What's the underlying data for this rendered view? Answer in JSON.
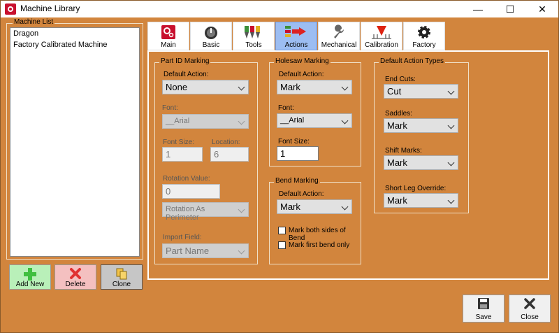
{
  "window": {
    "title": "Machine Library",
    "min_glyph": "—",
    "max_glyph": "☐",
    "close_glyph": "✕"
  },
  "machine_list": {
    "caption": "Machine List",
    "items": [
      "Dragon",
      "Factory Calibrated Machine"
    ]
  },
  "buttons": {
    "add_new": "Add New",
    "delete": "Delete",
    "clone": "Clone",
    "save": "Save",
    "close": "Close"
  },
  "tabs": [
    {
      "label": "Main",
      "icon": "main-settings-icon"
    },
    {
      "label": "Basic",
      "icon": "dial-icon"
    },
    {
      "label": "Tools",
      "icon": "tools-icon"
    },
    {
      "label": "Actions",
      "icon": "actions-icon"
    },
    {
      "label": "Mechanical",
      "icon": "wrench-icon"
    },
    {
      "label": "Calibration",
      "icon": "calibration-icon"
    },
    {
      "label": "Factory",
      "icon": "gear-icon"
    }
  ],
  "part_id": {
    "caption": "Part ID Marking",
    "default_action_label": "Default Action:",
    "default_action": "None",
    "font_label": "Font:",
    "font": "__Arial",
    "font_size_label": "Font Size:",
    "font_size": "1",
    "location_label": "Location:",
    "location": "6",
    "rotation_label": "Rotation Value:",
    "rotation_value": "0",
    "rotation_mode": "Rotation As Perimeter",
    "import_field_label": "Import Field:",
    "import_field": "Part Name"
  },
  "holesaw": {
    "caption": "Holesaw Marking",
    "default_action_label": "Default Action:",
    "default_action": "Mark",
    "font_label": "Font:",
    "font": "__Arial",
    "font_size_label": "Font Size:",
    "font_size": "1"
  },
  "bend": {
    "caption": "Bend Marking",
    "default_action_label": "Default Action:",
    "default_action": "Mark",
    "both_sides_label": "Mark both sides of Bend",
    "first_only_label": "Mark first bend only"
  },
  "default_types": {
    "caption": "Default Action Types",
    "end_cuts_label": "End Cuts:",
    "end_cuts": "Cut",
    "saddles_label": "Saddles:",
    "saddles": "Mark",
    "shift_marks_label": "Shift Marks:",
    "shift_marks": "Mark",
    "short_leg_label": "Short Leg Override:",
    "short_leg": "Mark"
  }
}
